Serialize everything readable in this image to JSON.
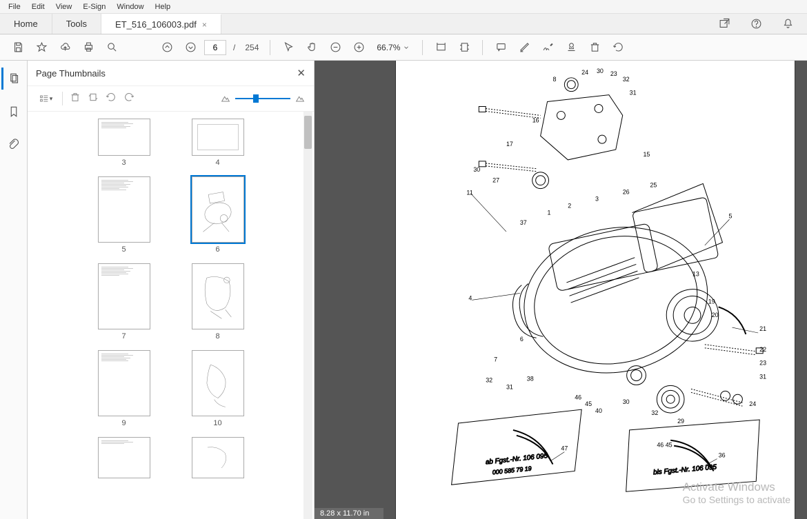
{
  "menu": {
    "items": [
      "File",
      "Edit",
      "View",
      "E-Sign",
      "Window",
      "Help"
    ]
  },
  "tabs": {
    "home": "Home",
    "tools": "Tools",
    "doc": "ET_516_106003.pdf"
  },
  "toolbar": {
    "page_current": "6",
    "page_total": "254",
    "page_sep": "/",
    "zoom": "66.7%"
  },
  "thumbs": {
    "title": "Page Thumbnails",
    "pages": [
      3,
      4,
      5,
      6,
      7,
      8,
      9,
      10
    ],
    "selected": 6
  },
  "status": {
    "page_size": "8.28 x 11.70 in"
  },
  "watermark": {
    "l1": "Activate Windows",
    "l2": "Go to Settings to activate"
  }
}
